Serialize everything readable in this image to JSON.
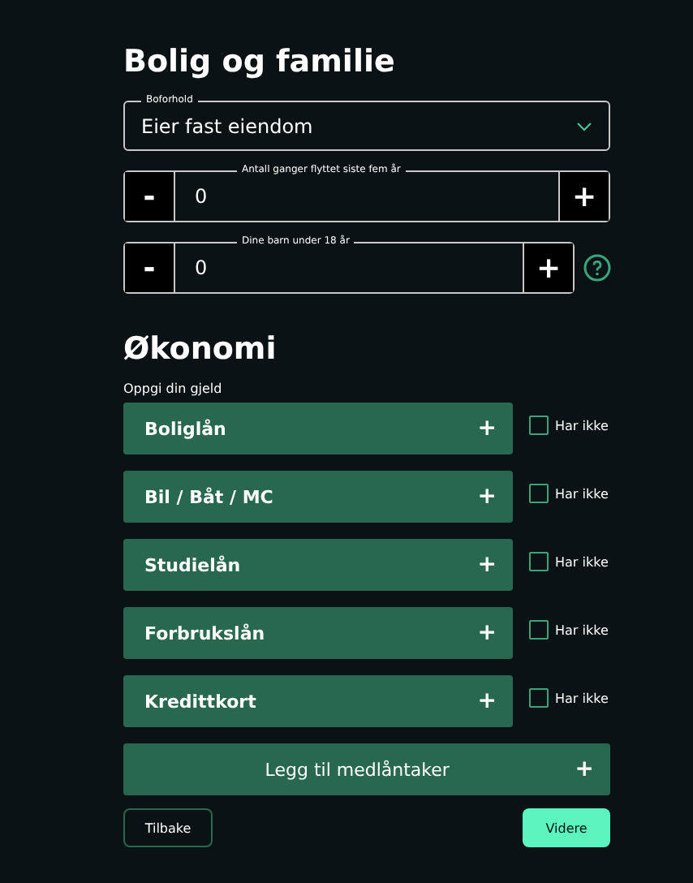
{
  "housing": {
    "title": "Bolig og familie",
    "select": {
      "label": "Boforhold",
      "value": "Eier fast eiendom"
    },
    "steppers": [
      {
        "label": "Antall ganger flyttet siste fem år",
        "value": "0",
        "minus": "-",
        "plus": "+",
        "help": false
      },
      {
        "label": "Dine barn under 18 år",
        "value": "0",
        "minus": "-",
        "plus": "+",
        "help": true
      }
    ]
  },
  "economy": {
    "title": "Økonomi",
    "subtitle": "Oppgi din gjeld",
    "debts": [
      {
        "label": "Boliglån",
        "plus": "+",
        "checkbox": "Har ikke",
        "checked": false
      },
      {
        "label": "Bil / Båt / MC",
        "plus": "+",
        "checkbox": "Har ikke",
        "checked": false
      },
      {
        "label": "Studielån",
        "plus": "+",
        "checkbox": "Har ikke",
        "checked": false
      },
      {
        "label": "Forbrukslån",
        "plus": "+",
        "checkbox": "Har ikke",
        "checked": false
      },
      {
        "label": "Kredittkort",
        "plus": "+",
        "checkbox": "Har ikke",
        "checked": false
      }
    ],
    "add": {
      "label": "Legg til medlåntaker",
      "plus": "+"
    }
  },
  "buttons": {
    "back": "Tilbake",
    "next": "Videre"
  }
}
